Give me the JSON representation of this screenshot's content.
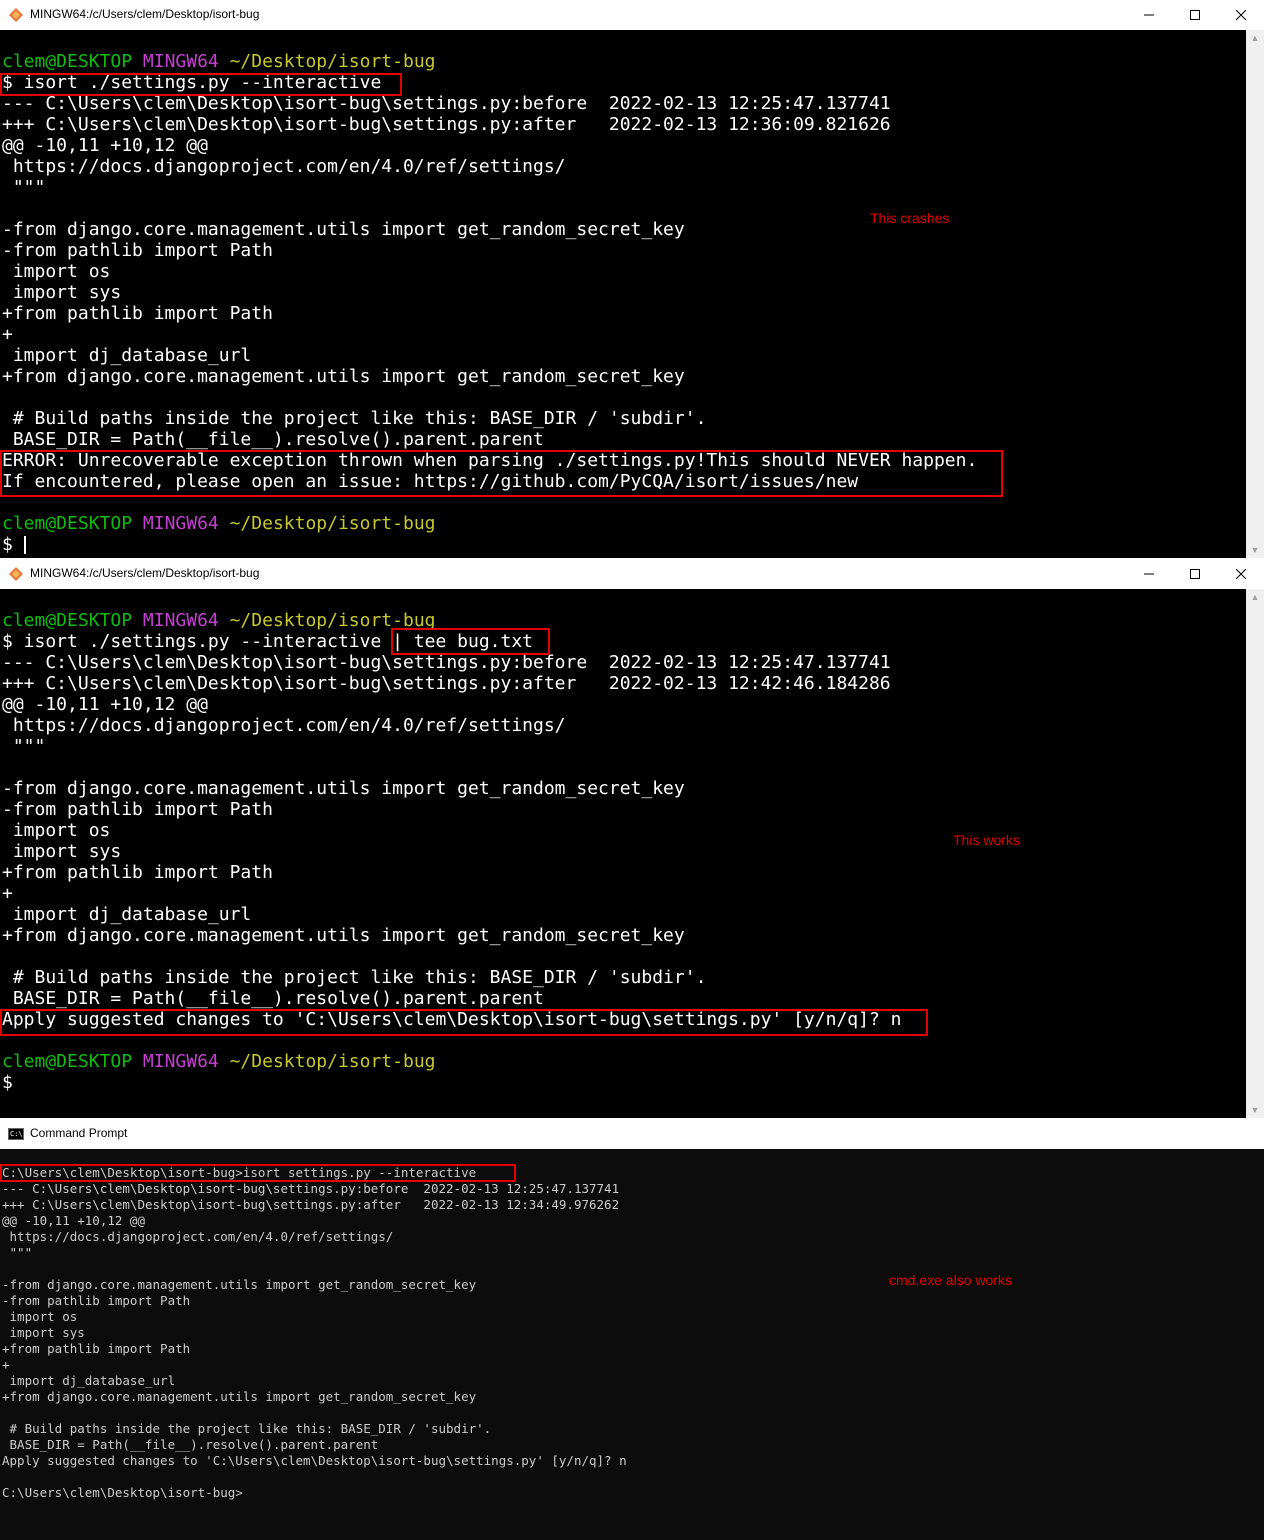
{
  "windows": [
    {
      "kind": "mintty",
      "title": "MINGW64:/c/Users/clem/Desktop/isort-bug",
      "lines": [
        [],
        [
          [
            "clem@DESKTOP",
            "green"
          ],
          [
            " ",
            ""
          ],
          [
            "MINGW64",
            "magenta"
          ],
          [
            " ",
            ""
          ],
          [
            "~/Desktop/isort-bug",
            "yellow"
          ]
        ],
        [
          [
            "$ isort ./settings.py --interactive",
            ""
          ]
        ],
        [
          [
            "--- C:\\Users\\clem\\Desktop\\isort-bug\\settings.py:before  2022-02-13 12:25:47.137741",
            ""
          ]
        ],
        [
          [
            "+++ C:\\Users\\clem\\Desktop\\isort-bug\\settings.py:after   2022-02-13 12:36:09.821626",
            ""
          ]
        ],
        [
          [
            "@@ -10,11 +10,12 @@",
            ""
          ]
        ],
        [
          [
            " https://docs.djangoproject.com/en/4.0/ref/settings/",
            ""
          ]
        ],
        [
          [
            " \"\"\"",
            ""
          ]
        ],
        [],
        [
          [
            "-from django.core.management.utils import get_random_secret_key",
            ""
          ]
        ],
        [
          [
            "-from pathlib import Path",
            ""
          ]
        ],
        [
          [
            " import os",
            ""
          ]
        ],
        [
          [
            " import sys",
            ""
          ]
        ],
        [
          [
            "+from pathlib import Path",
            ""
          ]
        ],
        [
          [
            "+",
            ""
          ]
        ],
        [
          [
            " import dj_database_url",
            ""
          ]
        ],
        [
          [
            "+from django.core.management.utils import get_random_secret_key",
            ""
          ]
        ],
        [],
        [
          [
            " # Build paths inside the project like this: BASE_DIR / 'subdir'.",
            ""
          ]
        ],
        [
          [
            " BASE_DIR = Path(__file__).resolve().parent.parent",
            ""
          ]
        ],
        [
          [
            "ERROR: Unrecoverable exception thrown when parsing ./settings.py!This should NEVER happen.",
            ""
          ]
        ],
        [
          [
            "If encountered, please open an issue: https://github.com/PyCQA/isort/issues/new",
            ""
          ]
        ],
        [],
        [
          [
            "clem@DESKTOP",
            "green"
          ],
          [
            " ",
            ""
          ],
          [
            "MINGW64",
            "magenta"
          ],
          [
            " ",
            ""
          ],
          [
            "~/Desktop/isort-bug",
            "yellow"
          ]
        ],
        [
          [
            "$ ",
            ""
          ]
        ]
      ],
      "annotation": "This crashes"
    },
    {
      "kind": "mintty",
      "title": "MINGW64:/c/Users/clem/Desktop/isort-bug",
      "lines": [
        [],
        [
          [
            "clem@DESKTOP",
            "green"
          ],
          [
            " ",
            ""
          ],
          [
            "MINGW64",
            "magenta"
          ],
          [
            " ",
            ""
          ],
          [
            "~/Desktop/isort-bug",
            "yellow"
          ]
        ],
        [
          [
            "$ isort ./settings.py --interactive | tee bug.txt",
            ""
          ]
        ],
        [
          [
            "--- C:\\Users\\clem\\Desktop\\isort-bug\\settings.py:before  2022-02-13 12:25:47.137741",
            ""
          ]
        ],
        [
          [
            "+++ C:\\Users\\clem\\Desktop\\isort-bug\\settings.py:after   2022-02-13 12:42:46.184286",
            ""
          ]
        ],
        [
          [
            "@@ -10,11 +10,12 @@",
            ""
          ]
        ],
        [
          [
            " https://docs.djangoproject.com/en/4.0/ref/settings/",
            ""
          ]
        ],
        [
          [
            " \"\"\"",
            ""
          ]
        ],
        [],
        [
          [
            "-from django.core.management.utils import get_random_secret_key",
            ""
          ]
        ],
        [
          [
            "-from pathlib import Path",
            ""
          ]
        ],
        [
          [
            " import os",
            ""
          ]
        ],
        [
          [
            " import sys",
            ""
          ]
        ],
        [
          [
            "+from pathlib import Path",
            ""
          ]
        ],
        [
          [
            "+",
            ""
          ]
        ],
        [
          [
            " import dj_database_url",
            ""
          ]
        ],
        [
          [
            "+from django.core.management.utils import get_random_secret_key",
            ""
          ]
        ],
        [],
        [
          [
            " # Build paths inside the project like this: BASE_DIR / 'subdir'.",
            ""
          ]
        ],
        [
          [
            " BASE_DIR = Path(__file__).resolve().parent.parent",
            ""
          ]
        ],
        [
          [
            "Apply suggested changes to 'C:\\Users\\clem\\Desktop\\isort-bug\\settings.py' [y/n/q]? n",
            ""
          ]
        ],
        [],
        [
          [
            "clem@DESKTOP",
            "green"
          ],
          [
            " ",
            ""
          ],
          [
            "MINGW64",
            "magenta"
          ],
          [
            " ",
            ""
          ],
          [
            "~/Desktop/isort-bug",
            "yellow"
          ]
        ],
        [
          [
            "$",
            ""
          ]
        ]
      ],
      "annotation": "This works"
    },
    {
      "kind": "cmd",
      "title": "Command Prompt",
      "lines": [
        [],
        [
          [
            "C:\\Users\\clem\\Desktop\\isort-bug>isort settings.py --interactive",
            ""
          ]
        ],
        [
          [
            "--- C:\\Users\\clem\\Desktop\\isort-bug\\settings.py:before  2022-02-13 12:25:47.137741",
            ""
          ]
        ],
        [
          [
            "+++ C:\\Users\\clem\\Desktop\\isort-bug\\settings.py:after   2022-02-13 12:34:49.976262",
            ""
          ]
        ],
        [
          [
            "@@ -10,11 +10,12 @@",
            ""
          ]
        ],
        [
          [
            " https://docs.djangoproject.com/en/4.0/ref/settings/",
            ""
          ]
        ],
        [
          [
            " \"\"\"",
            ""
          ]
        ],
        [],
        [
          [
            "-from django.core.management.utils import get_random_secret_key",
            ""
          ]
        ],
        [
          [
            "-from pathlib import Path",
            ""
          ]
        ],
        [
          [
            " import os",
            ""
          ]
        ],
        [
          [
            " import sys",
            ""
          ]
        ],
        [
          [
            "+from pathlib import Path",
            ""
          ]
        ],
        [
          [
            "+",
            ""
          ]
        ],
        [
          [
            " import dj_database_url",
            ""
          ]
        ],
        [
          [
            "+from django.core.management.utils import get_random_secret_key",
            ""
          ]
        ],
        [],
        [
          [
            " # Build paths inside the project like this: BASE_DIR / 'subdir'.",
            ""
          ]
        ],
        [
          [
            " BASE_DIR = Path(__file__).resolve().parent.parent",
            ""
          ]
        ],
        [
          [
            "Apply suggested changes to 'C:\\Users\\clem\\Desktop\\isort-bug\\settings.py' [y/n/q]? n",
            ""
          ]
        ],
        [],
        [
          [
            "C:\\Users\\clem\\Desktop\\isort-bug>",
            ""
          ]
        ]
      ],
      "annotation": "cmd.exe also works"
    }
  ],
  "colors": {
    "green": "#0dbc0d",
    "magenta": "#c53fd3",
    "yellow": "#c8c830",
    "annotation_red": "#e30000"
  },
  "window_controls": [
    "minimize-icon",
    "maximize-icon",
    "close-icon"
  ]
}
